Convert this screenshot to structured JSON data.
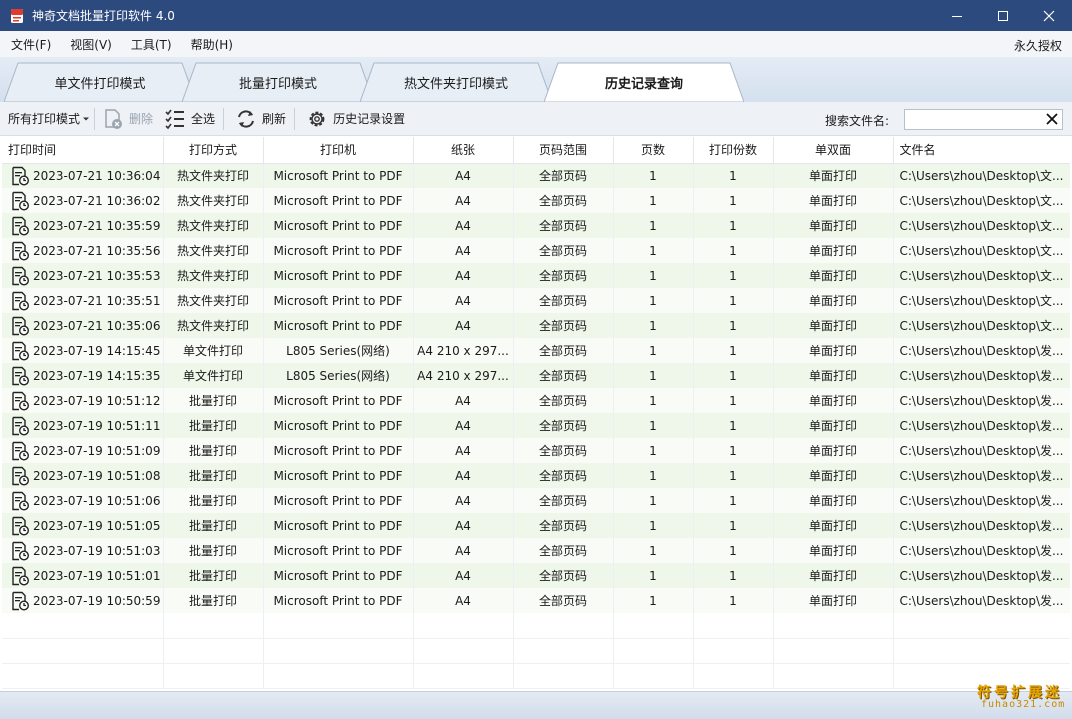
{
  "window": {
    "title": "神奇文档批量打印软件 4.0"
  },
  "menu": {
    "items": [
      "文件(F)",
      "视图(V)",
      "工具(T)",
      "帮助(H)"
    ],
    "license": "永久授权"
  },
  "tabs": [
    "单文件打印模式",
    "批量打印模式",
    "热文件夹打印模式",
    "历史记录查询"
  ],
  "toolbar": {
    "mode_filter": "所有打印模式",
    "delete": "删除",
    "select_all": "全选",
    "refresh": "刷新",
    "history_settings": "历史记录设置",
    "search_label": "搜索文件名:",
    "search_value": ""
  },
  "table": {
    "columns": [
      "打印时间",
      "打印方式",
      "打印机",
      "纸张",
      "页码范围",
      "页数",
      "打印份数",
      "单双面",
      "文件名"
    ],
    "rows": [
      [
        "2023-07-21 10:36:04",
        "热文件夹打印",
        "Microsoft Print to PDF",
        "A4",
        "全部页码",
        "1",
        "1",
        "单面打印",
        "C:\\Users\\zhou\\Desktop\\文..."
      ],
      [
        "2023-07-21 10:36:02",
        "热文件夹打印",
        "Microsoft Print to PDF",
        "A4",
        "全部页码",
        "1",
        "1",
        "单面打印",
        "C:\\Users\\zhou\\Desktop\\文..."
      ],
      [
        "2023-07-21 10:35:59",
        "热文件夹打印",
        "Microsoft Print to PDF",
        "A4",
        "全部页码",
        "1",
        "1",
        "单面打印",
        "C:\\Users\\zhou\\Desktop\\文..."
      ],
      [
        "2023-07-21 10:35:56",
        "热文件夹打印",
        "Microsoft Print to PDF",
        "A4",
        "全部页码",
        "1",
        "1",
        "单面打印",
        "C:\\Users\\zhou\\Desktop\\文..."
      ],
      [
        "2023-07-21 10:35:53",
        "热文件夹打印",
        "Microsoft Print to PDF",
        "A4",
        "全部页码",
        "1",
        "1",
        "单面打印",
        "C:\\Users\\zhou\\Desktop\\文..."
      ],
      [
        "2023-07-21 10:35:51",
        "热文件夹打印",
        "Microsoft Print to PDF",
        "A4",
        "全部页码",
        "1",
        "1",
        "单面打印",
        "C:\\Users\\zhou\\Desktop\\文..."
      ],
      [
        "2023-07-21 10:35:06",
        "热文件夹打印",
        "Microsoft Print to PDF",
        "A4",
        "全部页码",
        "1",
        "1",
        "单面打印",
        "C:\\Users\\zhou\\Desktop\\文..."
      ],
      [
        "2023-07-19 14:15:45",
        "单文件打印",
        "L805 Series(网络)",
        "A4 210 x 297...",
        "全部页码",
        "1",
        "1",
        "单面打印",
        "C:\\Users\\zhou\\Desktop\\发..."
      ],
      [
        "2023-07-19 14:15:35",
        "单文件打印",
        "L805 Series(网络)",
        "A4 210 x 297...",
        "全部页码",
        "1",
        "1",
        "单面打印",
        "C:\\Users\\zhou\\Desktop\\发..."
      ],
      [
        "2023-07-19 10:51:12",
        "批量打印",
        "Microsoft Print to PDF",
        "A4",
        "全部页码",
        "1",
        "1",
        "单面打印",
        "C:\\Users\\zhou\\Desktop\\发..."
      ],
      [
        "2023-07-19 10:51:11",
        "批量打印",
        "Microsoft Print to PDF",
        "A4",
        "全部页码",
        "1",
        "1",
        "单面打印",
        "C:\\Users\\zhou\\Desktop\\发..."
      ],
      [
        "2023-07-19 10:51:09",
        "批量打印",
        "Microsoft Print to PDF",
        "A4",
        "全部页码",
        "1",
        "1",
        "单面打印",
        "C:\\Users\\zhou\\Desktop\\发..."
      ],
      [
        "2023-07-19 10:51:08",
        "批量打印",
        "Microsoft Print to PDF",
        "A4",
        "全部页码",
        "1",
        "1",
        "单面打印",
        "C:\\Users\\zhou\\Desktop\\发..."
      ],
      [
        "2023-07-19 10:51:06",
        "批量打印",
        "Microsoft Print to PDF",
        "A4",
        "全部页码",
        "1",
        "1",
        "单面打印",
        "C:\\Users\\zhou\\Desktop\\发..."
      ],
      [
        "2023-07-19 10:51:05",
        "批量打印",
        "Microsoft Print to PDF",
        "A4",
        "全部页码",
        "1",
        "1",
        "单面打印",
        "C:\\Users\\zhou\\Desktop\\发..."
      ],
      [
        "2023-07-19 10:51:03",
        "批量打印",
        "Microsoft Print to PDF",
        "A4",
        "全部页码",
        "1",
        "1",
        "单面打印",
        "C:\\Users\\zhou\\Desktop\\发..."
      ],
      [
        "2023-07-19 10:51:01",
        "批量打印",
        "Microsoft Print to PDF",
        "A4",
        "全部页码",
        "1",
        "1",
        "单面打印",
        "C:\\Users\\zhou\\Desktop\\发..."
      ],
      [
        "2023-07-19 10:50:59",
        "批量打印",
        "Microsoft Print to PDF",
        "A4",
        "全部页码",
        "1",
        "1",
        "单面打印",
        "C:\\Users\\zhou\\Desktop\\发..."
      ]
    ]
  },
  "watermark": {
    "main": "符号扩展迷",
    "sub": "fuhao321.com"
  },
  "colors": {
    "titlebar": "#2c4a7e",
    "row_odd": "#eef7ea",
    "row_even": "#f8fbf6",
    "watermark": "#e8a400"
  }
}
